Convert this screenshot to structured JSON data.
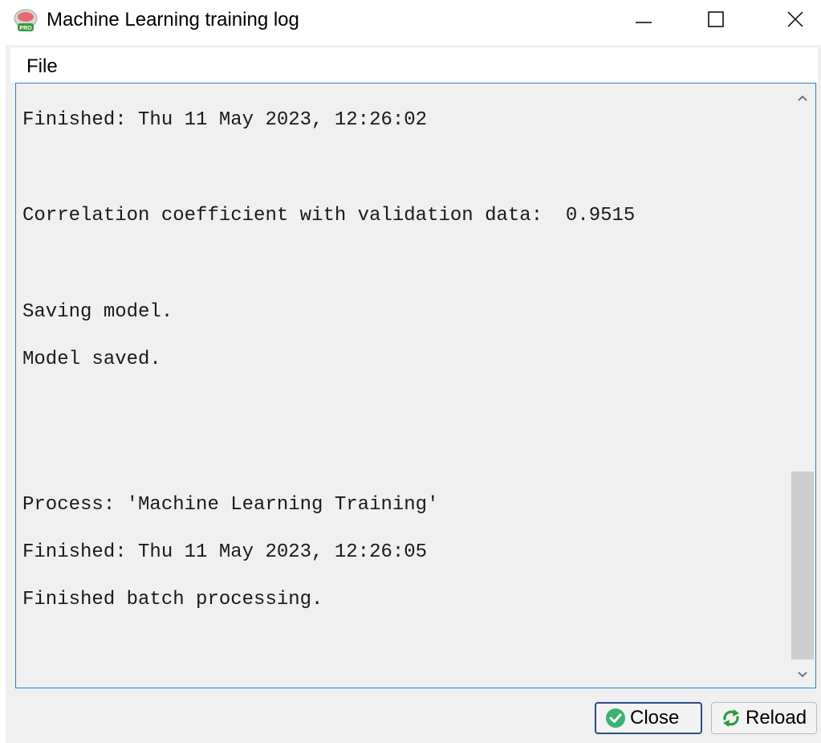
{
  "window": {
    "title": "Machine Learning training log"
  },
  "menu": {
    "file": "File"
  },
  "log": {
    "lines": [
      "Finished: Thu 11 May 2023, 12:26:02",
      "Correlation coefficient with validation data:  0.9515",
      "Saving model.",
      "Model saved.",
      "Process: 'Machine Learning Training'",
      "Finished: Thu 11 May 2023, 12:26:05",
      "Finished batch processing."
    ]
  },
  "buttons": {
    "close": "Close",
    "reload": "Reload"
  },
  "icons": {
    "app": "app-pro-icon",
    "close_button": "check-circle-icon",
    "reload_button": "reload-arrows-icon"
  },
  "colors": {
    "focus_border": "#2a7fd4",
    "close_check": "#3cb371",
    "reload_arrows": "#2e9a3e"
  }
}
